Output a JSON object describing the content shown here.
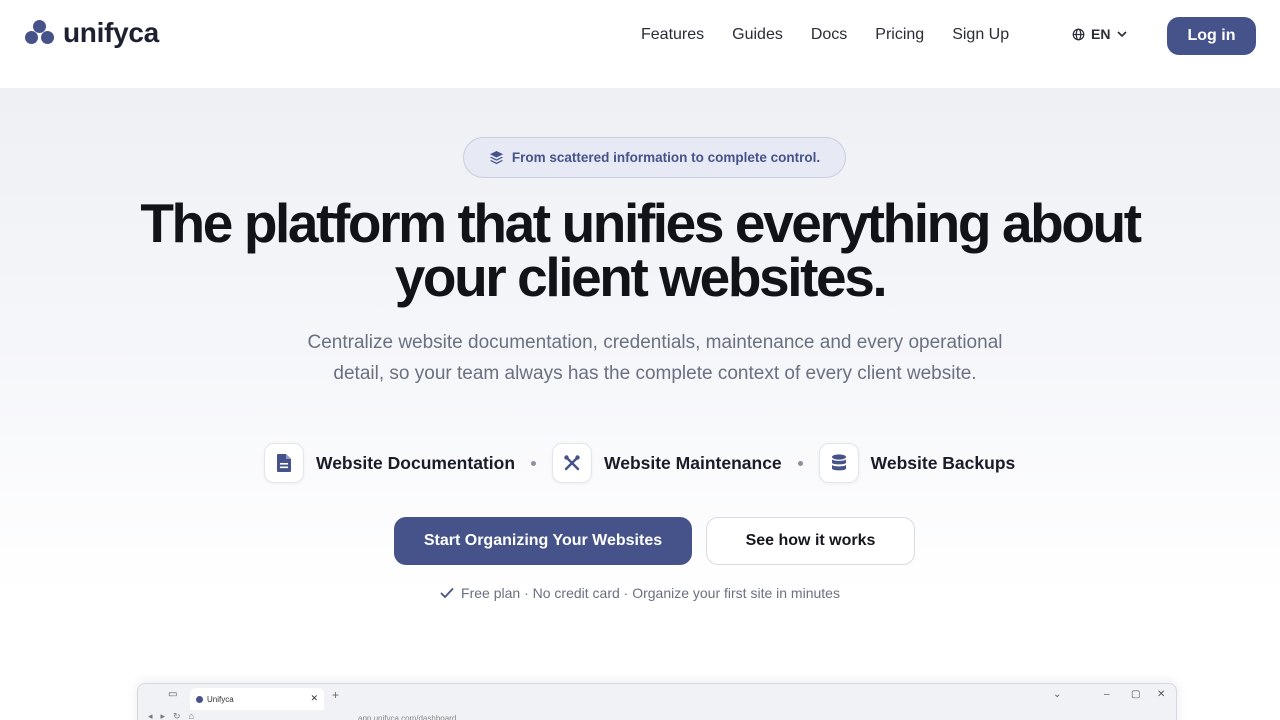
{
  "brand": {
    "name": "unifyca"
  },
  "nav": {
    "items": [
      {
        "label": "Features"
      },
      {
        "label": "Guides"
      },
      {
        "label": "Docs"
      },
      {
        "label": "Pricing"
      },
      {
        "label": "Sign Up"
      }
    ],
    "language": "EN",
    "login_label": "Log in"
  },
  "hero": {
    "pill_text": "From scattered information to complete control.",
    "headline_line1": "The platform that unifies everything about",
    "headline_line2": "your client websites.",
    "subtitle": "Centralize website documentation, credentials, maintenance and every operational detail, so your team always has the complete context of every client website.",
    "features": [
      {
        "label": "Website Documentation",
        "icon": "document-icon"
      },
      {
        "label": "Website Maintenance",
        "icon": "tools-icon"
      },
      {
        "label": "Website Backups",
        "icon": "database-icon"
      }
    ],
    "primary_cta": "Start Organizing Your Websites",
    "secondary_cta": "See how it works",
    "note": "Free plan · No credit card · Organize your first site in minutes"
  },
  "preview": {
    "tab_title": "Unifyca",
    "address": "app.unifyca.com/dashboard"
  },
  "colors": {
    "accent": "#45538a",
    "text": "#111318",
    "muted": "#6a7080"
  }
}
